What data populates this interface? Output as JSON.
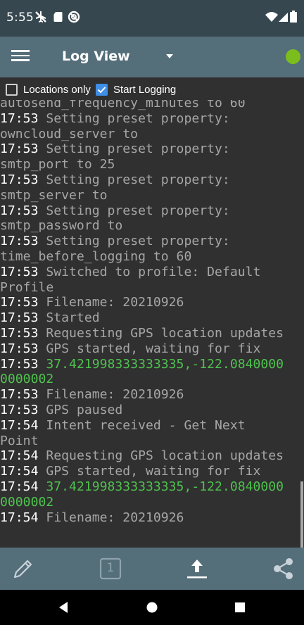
{
  "status_bar": {
    "time": "5:55"
  },
  "toolbar": {
    "title": "Log View"
  },
  "controls": {
    "locations_only": {
      "label": "Locations only",
      "checked": false
    },
    "start_logging": {
      "label": "Start Logging",
      "checked": true
    }
  },
  "log": [
    {
      "time": "",
      "text": "autosend_frequency_minutes to 60",
      "green": false
    },
    {
      "time": "17:53",
      "text": "Setting preset property:",
      "green": false
    },
    {
      "time": "",
      "text": "owncloud_server to",
      "green": false
    },
    {
      "time": "17:53",
      "text": "Setting preset property:",
      "green": false
    },
    {
      "time": "",
      "text": "smtp_port to 25",
      "green": false
    },
    {
      "time": "17:53",
      "text": "Setting preset property:",
      "green": false
    },
    {
      "time": "",
      "text": "smtp_server to",
      "green": false
    },
    {
      "time": "17:53",
      "text": "Setting preset property:",
      "green": false
    },
    {
      "time": "",
      "text": "smtp_password to",
      "green": false
    },
    {
      "time": "17:53",
      "text": "Setting preset property:",
      "green": false
    },
    {
      "time": "",
      "text": "time_before_logging to 60",
      "green": false
    },
    {
      "time": "17:53",
      "text": "Switched to profile: Default",
      "green": false
    },
    {
      "time": "",
      "text": "Profile",
      "green": false
    },
    {
      "time": "17:53",
      "text": "Filename: 20210926",
      "green": false
    },
    {
      "time": "17:53",
      "text": "Started",
      "green": false
    },
    {
      "time": "17:53",
      "text": "Requesting GPS location updates",
      "green": false
    },
    {
      "time": "17:53",
      "text": "GPS started, waiting for fix",
      "green": false
    },
    {
      "time": "17:53",
      "text": "37.421998333333335,-122.0840000",
      "green": true
    },
    {
      "time": "",
      "text": "0000002",
      "green": true
    },
    {
      "time": "17:53",
      "text": "Filename: 20210926",
      "green": false
    },
    {
      "time": "17:53",
      "text": "GPS paused",
      "green": false
    },
    {
      "time": "17:54",
      "text": "Intent received - Get Next",
      "green": false
    },
    {
      "time": "",
      "text": "Point",
      "green": false
    },
    {
      "time": "17:54",
      "text": "Requesting GPS location updates",
      "green": false
    },
    {
      "time": "17:54",
      "text": "GPS started, waiting for fix",
      "green": false
    },
    {
      "time": "17:54",
      "text": "37.421998333333335,-122.0840000",
      "green": true
    },
    {
      "time": "",
      "text": "0000002",
      "green": true
    },
    {
      "time": "17:54",
      "text": "Filename: 20210926",
      "green": false
    }
  ],
  "bottom_bar": {
    "page_number": "1"
  },
  "colors": {
    "toolbar": "#546e7a",
    "status_bar": "#37474f",
    "background": "#303030",
    "status_dot": "#7cbd1e",
    "coordinate_text": "#4fc14f",
    "checkbox_checked": "#3f8ee8"
  },
  "icons": {
    "menu": "hamburger-icon",
    "status": "status-dot",
    "edit": "pencil-icon",
    "page": "one-box-icon",
    "upload": "upload-icon",
    "share": "share-icon"
  }
}
